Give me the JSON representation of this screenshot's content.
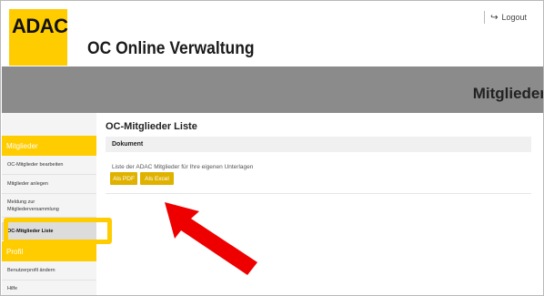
{
  "header": {
    "logo": "ADAC",
    "app_title": "OC Online Verwaltung",
    "logout_label": "Logout"
  },
  "banner": {
    "title": "Mitglieder"
  },
  "sidebar": {
    "sections": [
      {
        "title": "Mitglieder",
        "items": [
          {
            "label": "OC-Mitglieder bearbeiten"
          },
          {
            "label": "Mitglieder anlegen"
          },
          {
            "label": "Meldung zur",
            "label2": "Mitgliederversammlung"
          },
          {
            "label": "OC-Mitglieder Liste",
            "active": true
          }
        ]
      },
      {
        "title": "Profil",
        "items": [
          {
            "label": "Benutzerprofil ändern"
          },
          {
            "label": "Hilfe"
          }
        ]
      }
    ]
  },
  "main": {
    "title": "OC-Mitglieder Liste",
    "table_header": "Dokument",
    "description": "Liste der ADAC Mitglieder für Ihre eigenen Unterlagen",
    "btn_pdf": "Als PDF",
    "btn_excel": "Als Excel"
  },
  "colors": {
    "accent": "#ffcc00",
    "button": "#e0b200",
    "banner": "#8b8b8b",
    "annotation_arrow": "#ee0000"
  },
  "icons": {
    "logout": "sign-out-icon",
    "annotation": "red-arrow-icon"
  }
}
